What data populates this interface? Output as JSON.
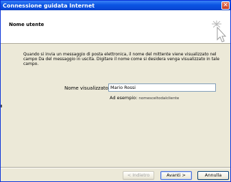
{
  "window": {
    "title": "Connessione guidata Internet",
    "close_glyph": "✕"
  },
  "header": {
    "title": "Nome utente",
    "icon": "wizard-cursor-icon"
  },
  "body": {
    "description": "Quando si invia un messaggio di posta elettronica, il nome del mittente viene visualizzato nel campo Da del messaggio in uscita. Digitare il nome come si desidera venga visualizzato in tale campo.",
    "name_label": "Nome visualizzato:",
    "name_value": "Mario Rossi",
    "example_label": "Ad esempio:",
    "example_value": "nomesceltodalcliente"
  },
  "buttons": {
    "back": "< Indietro",
    "next": "Avanti >",
    "cancel": "Annulla"
  },
  "colors": {
    "titlebar": "#0a54e3",
    "dialog_bg": "#ece9d8",
    "close_button": "#c73d1f"
  }
}
